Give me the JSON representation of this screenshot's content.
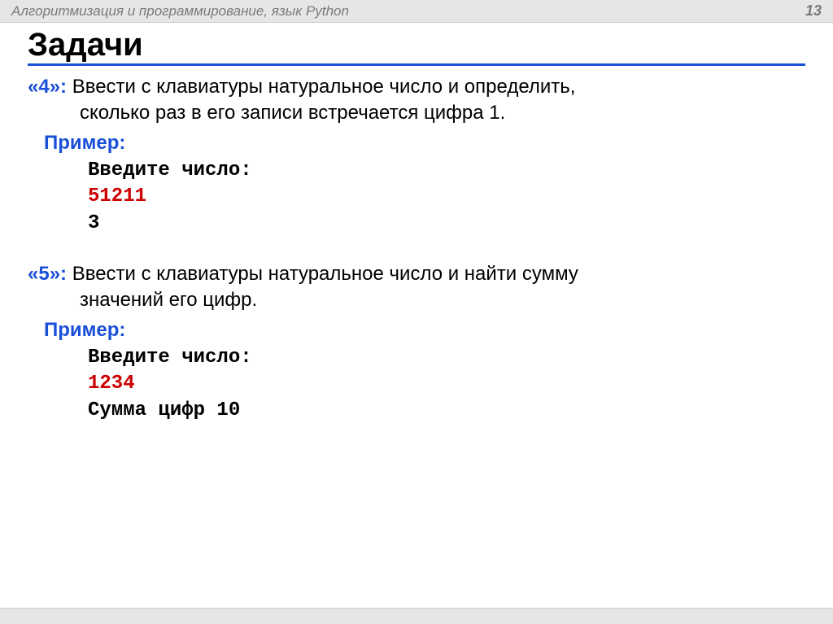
{
  "header": {
    "title": "Алгоритмизация и программирование, язык Python",
    "page_number": "13"
  },
  "heading": "Задачи",
  "tasks": [
    {
      "label": "«4»:",
      "text_line1": "Ввести с клавиатуры натуральное число и определить,",
      "text_line2": "сколько  раз в его записи встречается цифра 1.",
      "example_label": "Пример:",
      "code": {
        "prompt": "Введите число:",
        "input": "51211",
        "output": "3"
      }
    },
    {
      "label": "«5»:",
      "text_line1": "Ввести с клавиатуры натуральное число и найти сумму",
      "text_line2": "значений его цифр.",
      "example_label": "Пример:",
      "code": {
        "prompt": "Введите число:",
        "input": "1234",
        "output": "Сумма цифр 10"
      }
    }
  ]
}
